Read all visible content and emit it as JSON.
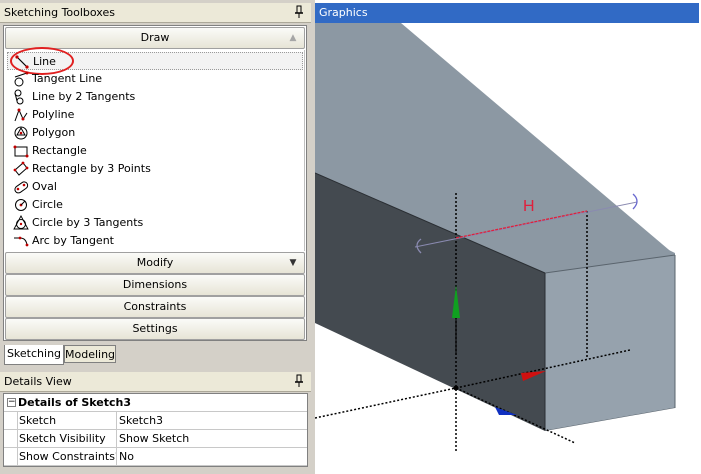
{
  "toolboxes": {
    "title": "Sketching Toolboxes",
    "groups": {
      "draw": "Draw",
      "modify": "Modify",
      "dimensions": "Dimensions",
      "constraints": "Constraints",
      "settings": "Settings"
    },
    "draw_items": [
      {
        "label": "Line",
        "icon": "line-icon",
        "selected": true
      },
      {
        "label": "Tangent Line",
        "icon": "tangent-line-icon"
      },
      {
        "label": "Line by 2 Tangents",
        "icon": "line-by-2-tangents-icon"
      },
      {
        "label": "Polyline",
        "icon": "polyline-icon"
      },
      {
        "label": "Polygon",
        "icon": "polygon-icon"
      },
      {
        "label": "Rectangle",
        "icon": "rectangle-icon"
      },
      {
        "label": "Rectangle by 3 Points",
        "icon": "rectangle-by-3-points-icon"
      },
      {
        "label": "Oval",
        "icon": "oval-icon"
      },
      {
        "label": "Circle",
        "icon": "circle-icon"
      },
      {
        "label": "Circle by 3 Tangents",
        "icon": "circle-by-3-tangents-icon"
      },
      {
        "label": "Arc by Tangent",
        "icon": "arc-by-tangent-icon"
      }
    ]
  },
  "tabs": {
    "sketching": "Sketching",
    "modeling": "Modeling"
  },
  "details": {
    "title": "Details View",
    "section": "Details of Sketch3",
    "rows": [
      {
        "key": "Sketch",
        "value": "Sketch3"
      },
      {
        "key": "Sketch Visibility",
        "value": "Show Sketch"
      },
      {
        "key": "Show Constraints?",
        "value": "No"
      }
    ]
  },
  "graphics": {
    "title": "Graphics",
    "dimension_label": "H"
  },
  "colors": {
    "selection_header": "#316ac5",
    "highlight_circle": "#e02020",
    "box_top": "#8c98a3",
    "box_front": "#444a50",
    "box_side": "#96a2ad",
    "dimension": "#e0203c",
    "axis_y": "#10a020",
    "axis_x": "#d01010",
    "axis_z": "#1030c0"
  }
}
